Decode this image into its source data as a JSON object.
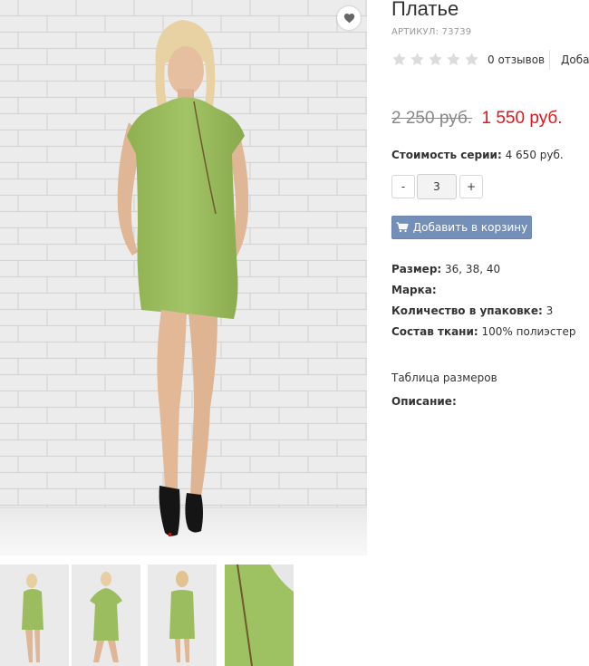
{
  "product": {
    "title": "Платье",
    "sku_label": "АРТИКУЛ:",
    "sku_value": "73739",
    "reviews_text": "0 отзывов",
    "add_review_text": "Добав",
    "old_price": "2 250 руб.",
    "new_price": "1 550 руб.",
    "series_label": "Стоимость серии:",
    "series_value": "4 650 руб.",
    "qty_minus": "-",
    "qty_value": "3",
    "qty_plus": "+",
    "add_to_cart": "Добавить в корзину",
    "size_table": "Таблица размеров",
    "description_label": "Описание:"
  },
  "rating": {
    "value": 0,
    "max": 5
  },
  "properties": [
    {
      "label": "Размер:",
      "value": "36, 38, 40"
    },
    {
      "label": "Марка:",
      "value": ""
    },
    {
      "label": "Количество в упаковке:",
      "value": "3"
    },
    {
      "label": "Состав ткани:",
      "value": "100% полиэстер"
    }
  ],
  "icons": {
    "favorite": "heart-icon",
    "cart": "shopping-cart-icon",
    "star": "star-icon"
  },
  "colors": {
    "new_price": "#e0161a",
    "old_price": "#888888",
    "cart_button": "#7590b8",
    "dress": "#9cbd5f",
    "star_empty": "#dcdcdc"
  }
}
